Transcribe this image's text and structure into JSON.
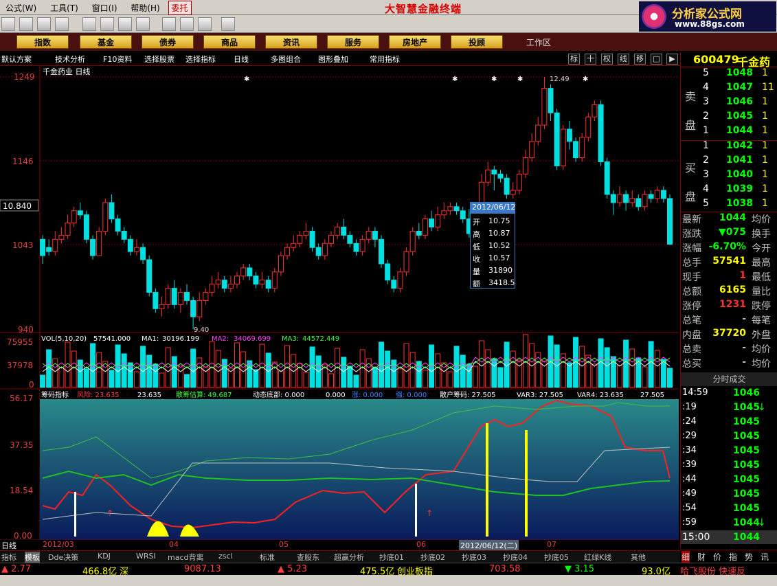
{
  "menu": {
    "items": [
      "公式(W)",
      "工具(T)",
      "窗口(I)",
      "帮助(H)"
    ],
    "entrust": "委托"
  },
  "promo": "大智慧金融终端",
  "logo": {
    "title": "分析家公式网",
    "url": "www.88gs.com"
  },
  "tabs": [
    "指数",
    "基金",
    "债券",
    "商品",
    "资讯",
    "服务",
    "房地产",
    "投顾"
  ],
  "workspace": "工作区",
  "func": {
    "items": [
      "默认方案",
      "技术分析",
      "F10资料",
      "选择股票",
      "选择指标",
      "日线",
      "多图组合",
      "图形叠加",
      "常用指标"
    ],
    "buttons": [
      "标",
      "十",
      "权",
      "线",
      "移",
      "□",
      "▶"
    ]
  },
  "stock": {
    "code": "600479",
    "name": "千金药业",
    "period": "日线",
    "title": "千金药业 日线"
  },
  "price_axis": {
    "top": "1249",
    "mid": "1146",
    "cur": "10.840",
    "low": "1043",
    "bottom": "940"
  },
  "annotations": {
    "high": "12.49",
    "low": "9.40"
  },
  "tooltip": {
    "date": "2012/06/12",
    "rows": [
      [
        "开",
        "10.75"
      ],
      [
        "高",
        "10.87"
      ],
      [
        "低",
        "10.52"
      ],
      [
        "收",
        "10.57"
      ],
      [
        "量",
        "31890"
      ],
      [
        "额",
        "3418.5"
      ]
    ]
  },
  "vol": {
    "legend": "VOL(5,10,20)",
    "v": "57541.000",
    "ma1_label": "MA1:",
    "ma1": "30196.199",
    "ma2_label": "MA2:",
    "ma2": "34069.699",
    "ma3_label": "MA3:",
    "ma3": "44572.449",
    "axis_top": "75955",
    "axis_mid": "37978",
    "axis_zero": "0"
  },
  "ind": {
    "name": "筹码指标",
    "risk": "风险: 23.635",
    "risk2": "23.635",
    "sanhu": "散筹估算: 49.687",
    "dongtai": "动态底部: 0.000",
    "zero": "0.000",
    "zhang": "涨: 0.000",
    "qiang": "强: 0.000",
    "shp": "散户筹码: 27.505",
    "var3": "VAR3: 27.505",
    "var4": "VAR4: 23.635",
    "v5": "27.505",
    "axis": [
      "56.17",
      "37.35",
      "18.54",
      "0.00"
    ]
  },
  "dates": {
    "label": "日线",
    "d1": "2012/03",
    "d2": "04",
    "d3": "05",
    "d4": "06",
    "d5": "2012/06/12(二)",
    "d6": "07"
  },
  "quote": {
    "code": "600479",
    "name": "千金药",
    "sell": [
      [
        "5",
        "1048"
      ],
      [
        "4",
        "1047"
      ],
      [
        "3",
        "1046"
      ],
      [
        "2",
        "1045"
      ],
      [
        "1",
        "1044"
      ]
    ],
    "buy": [
      [
        "1",
        "1042"
      ],
      [
        "2",
        "1041"
      ],
      [
        "3",
        "1040"
      ],
      [
        "4",
        "1039"
      ],
      [
        "5",
        "1038"
      ]
    ],
    "sell_vol": [
      "1",
      "11",
      "1",
      "1",
      "1"
    ],
    "buy_vol": [
      "1",
      "1",
      "1",
      "1",
      "1"
    ],
    "ask_label": "卖盘",
    "bid_label": "买盘",
    "stats": [
      [
        "最新",
        "1044",
        "均价"
      ],
      [
        "涨跌",
        "▼075",
        "换手"
      ],
      [
        "涨幅",
        "-6.70%",
        "今开"
      ],
      [
        "总手",
        "57541",
        "最高"
      ],
      [
        "现手",
        "1",
        "最低"
      ],
      [
        "总额",
        "6165",
        "量比"
      ],
      [
        "涨停",
        "1231",
        "跌停"
      ],
      [
        "总笔",
        "-",
        "每笔"
      ],
      [
        "内盘",
        "37720",
        "外盘"
      ],
      [
        "总卖",
        "-",
        "均价"
      ],
      [
        "总买",
        "-",
        "均价"
      ]
    ],
    "ticks_label": "分时成交",
    "ticks": [
      [
        "14:59",
        "1046",
        ""
      ],
      [
        ":19",
        "1045",
        "↓"
      ],
      [
        ":24",
        "1045",
        ""
      ],
      [
        ":29",
        "1045",
        ""
      ],
      [
        ":34",
        "1045",
        ""
      ],
      [
        ":39",
        "1045",
        ""
      ],
      [
        ":44",
        "1045",
        ""
      ],
      [
        ":49",
        "1045",
        ""
      ],
      [
        ":54",
        "1045",
        ""
      ],
      [
        ":59",
        "1044",
        "↓"
      ]
    ],
    "close": [
      "15:00",
      "1044"
    ],
    "rtabs": [
      "细",
      "财",
      "价",
      "指",
      "势",
      "讯"
    ]
  },
  "bottomtabs": [
    "指标",
    "模板",
    "Dde决策",
    "KDJ",
    "WRSI",
    "macd背离",
    "zscl",
    "标准",
    "查股东",
    "超赢分析",
    "抄底01",
    "抄底02",
    "抄底03",
    "抄底04",
    "抄底05",
    "红绿K线",
    "其他"
  ],
  "status": {
    "s1": "▲ 2.77",
    "s2": "466.8亿",
    "s3": "深",
    "s4": "9087.13",
    "s5": "▲ 5.23",
    "s6": "475.5亿",
    "s7": "创业板指",
    "s8": "703.58",
    "s9": "▼ 3.15",
    "s10": "93.0亿",
    "s11": "哈飞股份 快速反"
  },
  "candles": [
    [
      10.5,
      10.3,
      10.55,
      10.2
    ],
    [
      10.4,
      10.35,
      10.5,
      10.3
    ],
    [
      10.35,
      10.5,
      10.6,
      10.3
    ],
    [
      10.5,
      10.55,
      10.65,
      10.45
    ],
    [
      10.55,
      10.7,
      10.8,
      10.5
    ],
    [
      10.7,
      10.85,
      10.9,
      10.65
    ],
    [
      10.85,
      10.8,
      10.95,
      10.75
    ],
    [
      10.8,
      10.5,
      10.85,
      10.45
    ],
    [
      10.5,
      10.3,
      10.55,
      10.25
    ],
    [
      10.3,
      10.6,
      10.65,
      10.3
    ],
    [
      10.6,
      10.95,
      11.0,
      10.55
    ],
    [
      10.95,
      10.75,
      11.05,
      10.7
    ],
    [
      10.75,
      10.6,
      10.8,
      10.55
    ],
    [
      10.6,
      10.5,
      10.65,
      10.45
    ],
    [
      10.5,
      10.35,
      10.55,
      10.3
    ],
    [
      10.35,
      10.4,
      10.5,
      10.3
    ],
    [
      10.4,
      10.25,
      10.45,
      10.2
    ],
    [
      10.25,
      9.85,
      10.3,
      9.8
    ],
    [
      9.85,
      9.65,
      9.9,
      9.6
    ],
    [
      9.65,
      9.7,
      9.8,
      9.55
    ],
    [
      9.7,
      9.9,
      9.95,
      9.65
    ],
    [
      9.9,
      9.7,
      10.0,
      9.65
    ],
    [
      9.7,
      9.85,
      9.9,
      9.6
    ],
    [
      9.85,
      9.75,
      9.95,
      9.7
    ],
    [
      9.75,
      9.55,
      9.8,
      9.4
    ],
    [
      9.55,
      9.75,
      9.85,
      9.5
    ],
    [
      9.75,
      9.85,
      9.9,
      9.7
    ],
    [
      9.85,
      9.95,
      10.05,
      9.8
    ],
    [
      9.95,
      10.0,
      10.1,
      9.9
    ],
    [
      10.0,
      9.9,
      10.05,
      9.85
    ],
    [
      9.9,
      9.95,
      10.05,
      9.85
    ],
    [
      9.95,
      10.05,
      10.1,
      9.9
    ],
    [
      10.05,
      10.15,
      10.2,
      10.0
    ],
    [
      10.15,
      10.05,
      10.2,
      10.0
    ],
    [
      10.05,
      9.95,
      10.1,
      9.9
    ],
    [
      9.95,
      10.0,
      10.1,
      9.9
    ],
    [
      10.0,
      9.9,
      10.05,
      9.85
    ],
    [
      9.9,
      10.1,
      10.15,
      9.85
    ],
    [
      10.1,
      10.3,
      10.35,
      10.05
    ],
    [
      10.3,
      10.4,
      10.45,
      10.25
    ],
    [
      10.4,
      10.45,
      10.55,
      10.35
    ],
    [
      10.45,
      10.55,
      10.6,
      10.4
    ],
    [
      10.55,
      10.6,
      10.7,
      10.5
    ],
    [
      10.6,
      10.4,
      10.65,
      10.35
    ],
    [
      10.4,
      10.3,
      10.45,
      10.25
    ],
    [
      10.3,
      10.45,
      10.5,
      10.25
    ],
    [
      10.45,
      10.55,
      10.6,
      10.4
    ],
    [
      10.55,
      10.65,
      10.7,
      10.5
    ],
    [
      10.65,
      10.55,
      10.75,
      10.5
    ],
    [
      10.55,
      10.45,
      10.6,
      10.4
    ],
    [
      10.45,
      10.35,
      10.5,
      10.3
    ],
    [
      10.35,
      10.5,
      10.55,
      10.3
    ],
    [
      10.5,
      10.6,
      10.65,
      10.45
    ],
    [
      10.6,
      10.5,
      10.65,
      10.4
    ],
    [
      10.5,
      10.2,
      10.55,
      10.15
    ],
    [
      10.2,
      10.0,
      10.25,
      9.95
    ],
    [
      10.0,
      9.9,
      10.05,
      9.85
    ],
    [
      9.9,
      10.1,
      10.15,
      9.85
    ],
    [
      10.1,
      10.35,
      10.4,
      10.05
    ],
    [
      10.35,
      10.6,
      10.65,
      10.3
    ],
    [
      10.6,
      10.55,
      10.7,
      10.5
    ],
    [
      10.55,
      10.75,
      10.8,
      10.5
    ],
    [
      10.75,
      10.65,
      10.85,
      10.6
    ],
    [
      10.65,
      10.8,
      10.9,
      10.6
    ],
    [
      10.8,
      10.85,
      10.95,
      10.75
    ],
    [
      10.85,
      10.9,
      10.95,
      10.8
    ],
    [
      10.9,
      10.85,
      10.95,
      10.8
    ],
    [
      10.85,
      10.75,
      10.9,
      10.7
    ],
    [
      10.75,
      10.57,
      10.87,
      10.52
    ],
    [
      10.57,
      10.9,
      10.95,
      10.55
    ],
    [
      10.9,
      11.2,
      11.3,
      10.85
    ],
    [
      11.2,
      11.35,
      11.45,
      11.15
    ],
    [
      11.35,
      11.3,
      11.4,
      11.1
    ],
    [
      11.3,
      11.25,
      11.35,
      11.2
    ],
    [
      11.25,
      11.05,
      11.3,
      11.0
    ],
    [
      11.05,
      11.1,
      11.2,
      11.0
    ],
    [
      11.1,
      11.3,
      11.35,
      11.05
    ],
    [
      11.3,
      11.5,
      11.6,
      11.25
    ],
    [
      11.5,
      11.7,
      11.8,
      11.45
    ],
    [
      11.7,
      11.9,
      12.0,
      11.65
    ],
    [
      11.9,
      12.35,
      12.49,
      11.85
    ],
    [
      12.35,
      12.05,
      12.4,
      11.95
    ],
    [
      12.05,
      11.4,
      12.1,
      11.35
    ],
    [
      11.4,
      11.85,
      11.9,
      11.35
    ],
    [
      11.85,
      11.7,
      11.95,
      11.6
    ],
    [
      11.7,
      11.5,
      11.75,
      11.45
    ],
    [
      11.5,
      11.75,
      11.8,
      11.45
    ],
    [
      11.75,
      12.0,
      12.05,
      11.7
    ],
    [
      12.0,
      12.15,
      12.2,
      11.95
    ],
    [
      12.15,
      11.45,
      12.2,
      11.4
    ],
    [
      11.45,
      11.05,
      11.5,
      11.0
    ],
    [
      11.05,
      10.95,
      11.1,
      10.8
    ],
    [
      10.95,
      11.05,
      11.15,
      10.9
    ],
    [
      11.05,
      10.95,
      11.1,
      10.85
    ],
    [
      10.95,
      11.0,
      11.1,
      10.9
    ],
    [
      11.0,
      10.9,
      11.05,
      10.85
    ],
    [
      10.9,
      11.05,
      11.1,
      10.85
    ],
    [
      11.05,
      11.0,
      11.1,
      10.95
    ],
    [
      11.0,
      11.1,
      11.15,
      10.95
    ],
    [
      11.1,
      11.0,
      11.15,
      10.95
    ],
    [
      11.0,
      10.44,
      11.05,
      10.43
    ]
  ]
}
